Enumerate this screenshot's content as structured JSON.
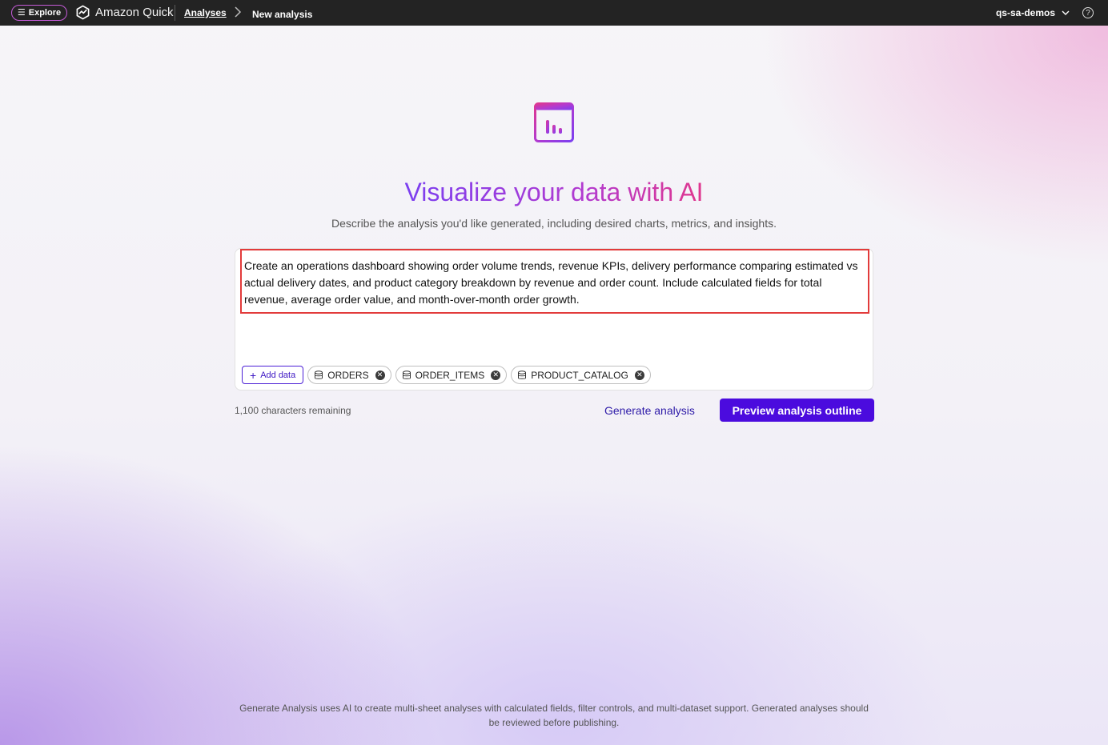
{
  "topbar": {
    "explore_label": "Explore",
    "brand_label": "Amazon Quick",
    "breadcrumb_link": "Analyses",
    "breadcrumb_current": "New analysis",
    "account_label": "qs-sa-demos",
    "help_glyph": "?"
  },
  "hero": {
    "title": "Visualize your data with AI",
    "subtitle": "Describe the analysis you'd like generated, including desired charts, metrics, and insights."
  },
  "prompt": {
    "text": "Create an operations dashboard showing order volume trends, revenue KPIs, delivery performance comparing estimated vs actual delivery dates, and product category breakdown by revenue and order count. Include calculated fields for total revenue, average order value, and month-over-month order growth."
  },
  "datasets": {
    "add_label": "Add data",
    "items": [
      {
        "label": "ORDERS"
      },
      {
        "label": "ORDER_ITEMS"
      },
      {
        "label": "PRODUCT_CATALOG"
      }
    ]
  },
  "actions": {
    "chars_remaining": "1,100 characters remaining",
    "generate_label": "Generate analysis",
    "preview_label": "Preview analysis outline"
  },
  "footer": {
    "note": "Generate Analysis uses AI to create multi-sheet analyses with calculated fields, filter controls, and multi-dataset support. Generated analyses should be reviewed before publishing."
  },
  "colors": {
    "primary_button": "#4b0bde",
    "prompt_highlight": "#e23b3b",
    "topbar": "#232323"
  }
}
